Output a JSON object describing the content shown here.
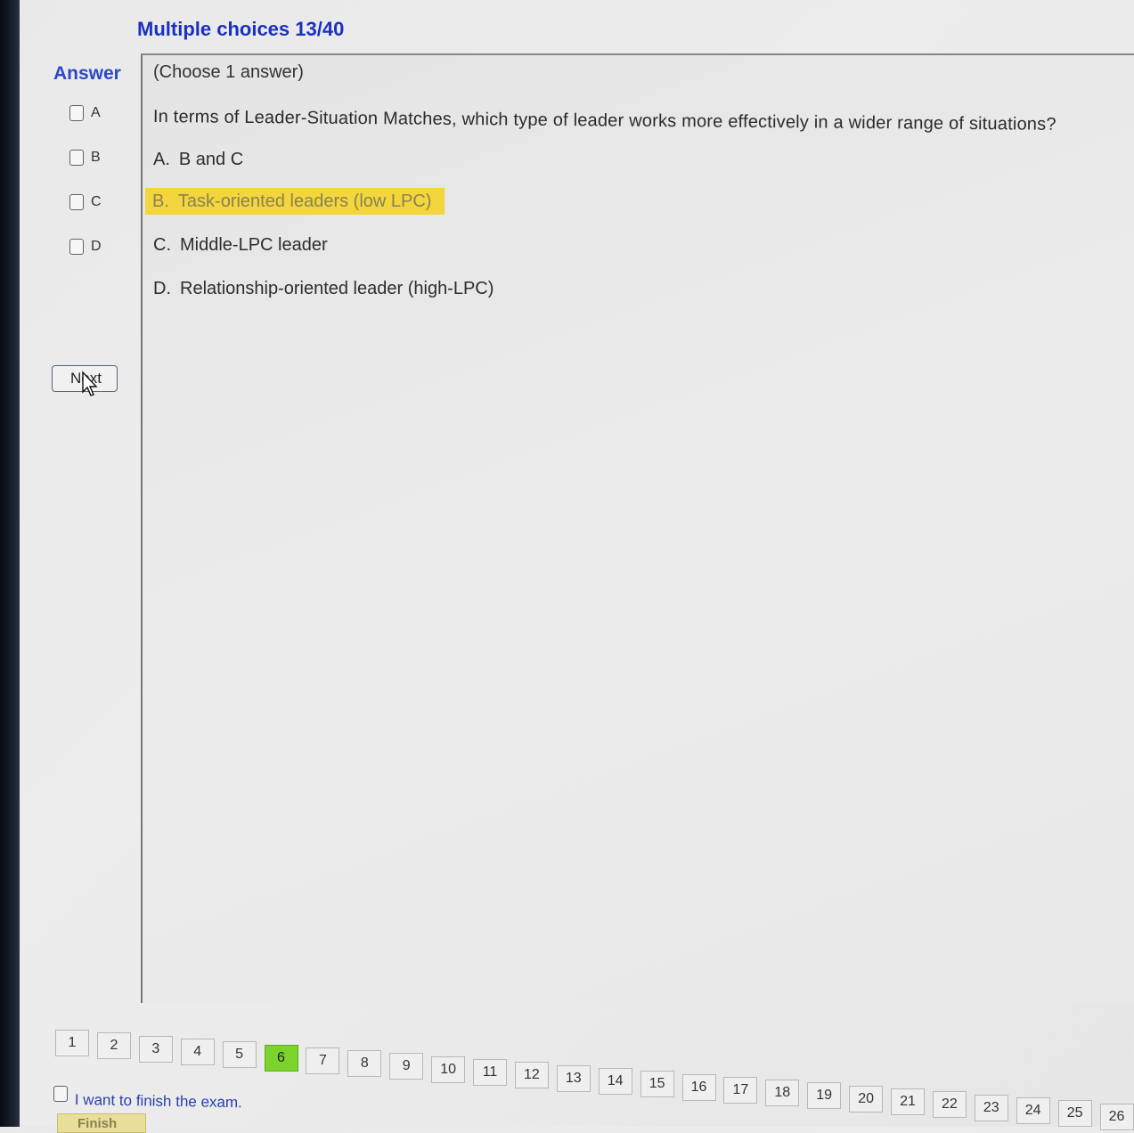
{
  "header": {
    "title": "Multiple choices 13/40"
  },
  "answer_panel": {
    "heading": "Answer",
    "options": [
      "A",
      "B",
      "C",
      "D"
    ],
    "next_label": "Next"
  },
  "question": {
    "hint": "(Choose 1 answer)",
    "text": "In terms of Leader-Situation Matches, which type of leader works more effectively in a wider range of situations?",
    "choices": [
      {
        "letter": "A.",
        "text": "B and C"
      },
      {
        "letter": "B.",
        "text": "Task-oriented leaders (low LPC)"
      },
      {
        "letter": "C.",
        "text": "Middle-LPC leader"
      },
      {
        "letter": "D.",
        "text": "Relationship-oriented leader (high-LPC)"
      }
    ],
    "highlight_color": "#f3d63b"
  },
  "pagination": {
    "pages": [
      "1",
      "2",
      "3",
      "4",
      "5",
      "6",
      "7",
      "8",
      "9",
      "10",
      "11",
      "12",
      "13",
      "14",
      "15",
      "16",
      "17",
      "18",
      "19",
      "20",
      "21",
      "22",
      "23",
      "24",
      "25",
      "26"
    ],
    "current": "6",
    "current_color": "#7bd32c"
  },
  "footer": {
    "finish_checkbox_label": "I want to finish the exam.",
    "finish_button_label": "Finish"
  },
  "icons": {
    "cursor": "mouse-pointer-icon"
  }
}
